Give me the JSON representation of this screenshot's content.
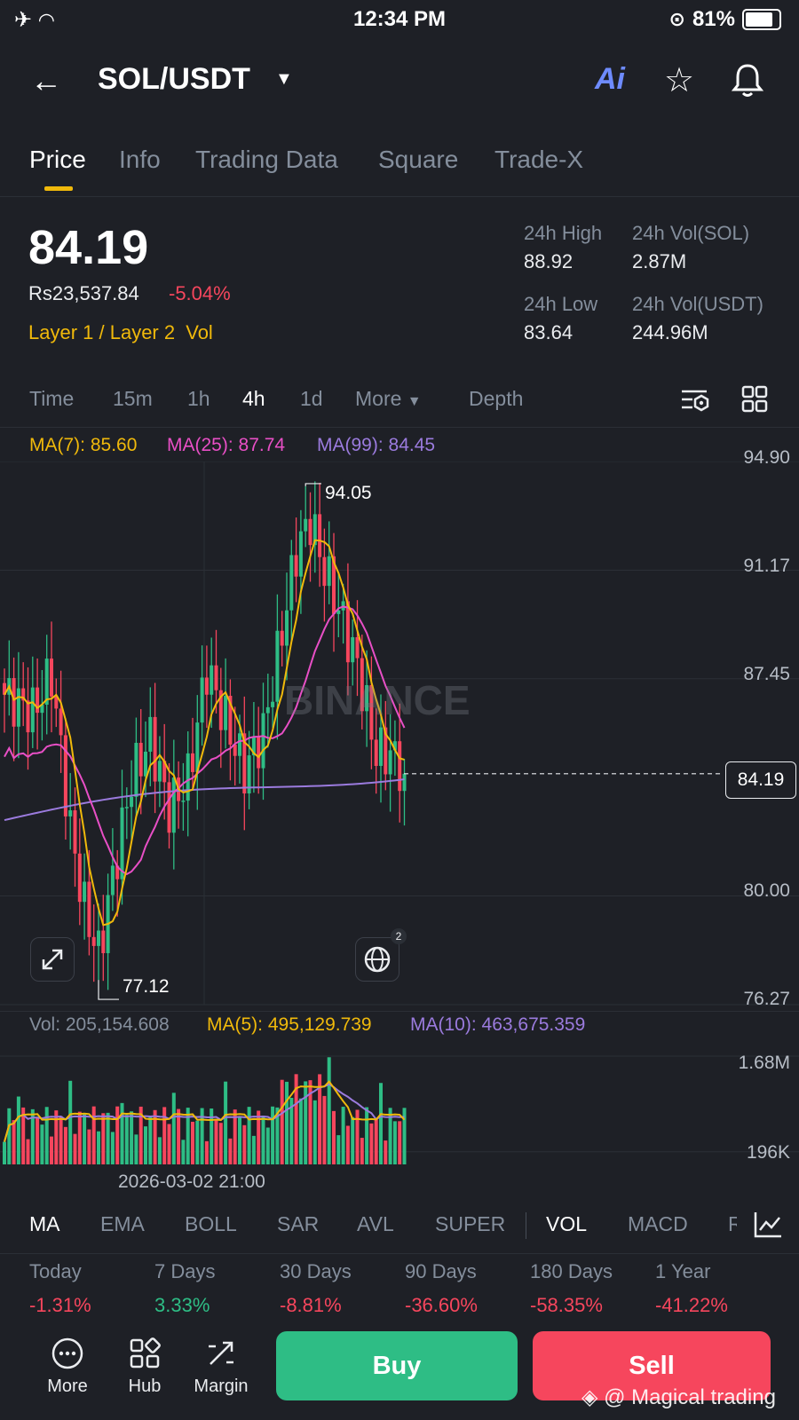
{
  "status_bar": {
    "time": "12:34 PM",
    "battery": "81%"
  },
  "header": {
    "back_icon": "arrow-left-icon",
    "pair": "SOL/USDT",
    "ai_label": "Ai"
  },
  "tabs": [
    "Price",
    "Info",
    "Trading Data",
    "Square",
    "Trade-X"
  ],
  "ticker": {
    "price": "84.19",
    "fiat": "Rs23,537.84",
    "change": "-5.04%",
    "tags": "Layer 1 / Layer 2",
    "tag_vol": "Vol",
    "high_label": "24h High",
    "high_value": "88.92",
    "volsol_label": "24h Vol(SOL)",
    "volsol_value": "2.87M",
    "low_label": "24h Low",
    "low_value": "83.64",
    "volusdt_label": "24h Vol(USDT)",
    "volusdt_value": "244.96M"
  },
  "timeframes": [
    "Time",
    "15m",
    "1h",
    "4h",
    "1d",
    "More",
    "Depth"
  ],
  "chart": {
    "ma7": "MA(7): 85.60",
    "ma25": "MA(25): 87.74",
    "ma99": "MA(99): 84.45",
    "axis": [
      "94.90",
      "91.17",
      "87.45",
      "84.19",
      "80.00",
      "76.27"
    ],
    "high_marker": "94.05",
    "low_marker": "77.12",
    "current_price": "84.19",
    "watermark": "BINANCE",
    "globe_badge": "2",
    "colors": {
      "up": "#2ebd85",
      "down": "#f6465d",
      "ma7": "#f0b90b",
      "ma25": "#e84fc6",
      "ma99": "#9b7bde"
    }
  },
  "volume": {
    "vol": "Vol: 205,154.608",
    "ma5": "MA(5): 495,129.739",
    "ma10": "MA(10): 463,675.359",
    "axis_top": "1.68M",
    "axis_bottom": "196K",
    "date": "2026-03-02 21:00"
  },
  "indicators": [
    "MA",
    "EMA",
    "BOLL",
    "SAR",
    "AVL",
    "SUPER",
    "VOL",
    "MACD",
    "R"
  ],
  "performance": [
    {
      "label": "Today",
      "value": "-1.31%",
      "color": "#f6465d"
    },
    {
      "label": "7 Days",
      "value": "3.33%",
      "color": "#2ebd85"
    },
    {
      "label": "30 Days",
      "value": "-8.81%",
      "color": "#f6465d"
    },
    {
      "label": "90 Days",
      "value": "-36.60%",
      "color": "#f6465d"
    },
    {
      "label": "180 Days",
      "value": "-58.35%",
      "color": "#f6465d"
    },
    {
      "label": "1 Year",
      "value": "-41.22%",
      "color": "#f6465d"
    }
  ],
  "bottom_nav": [
    {
      "label": "More",
      "icon": "more-dots-icon"
    },
    {
      "label": "Hub",
      "icon": "hub-grid-icon"
    },
    {
      "label": "Margin",
      "icon": "margin-icon"
    }
  ],
  "actions": {
    "buy": "Buy",
    "sell": "Sell"
  },
  "watermark": "@ Magical trading"
}
